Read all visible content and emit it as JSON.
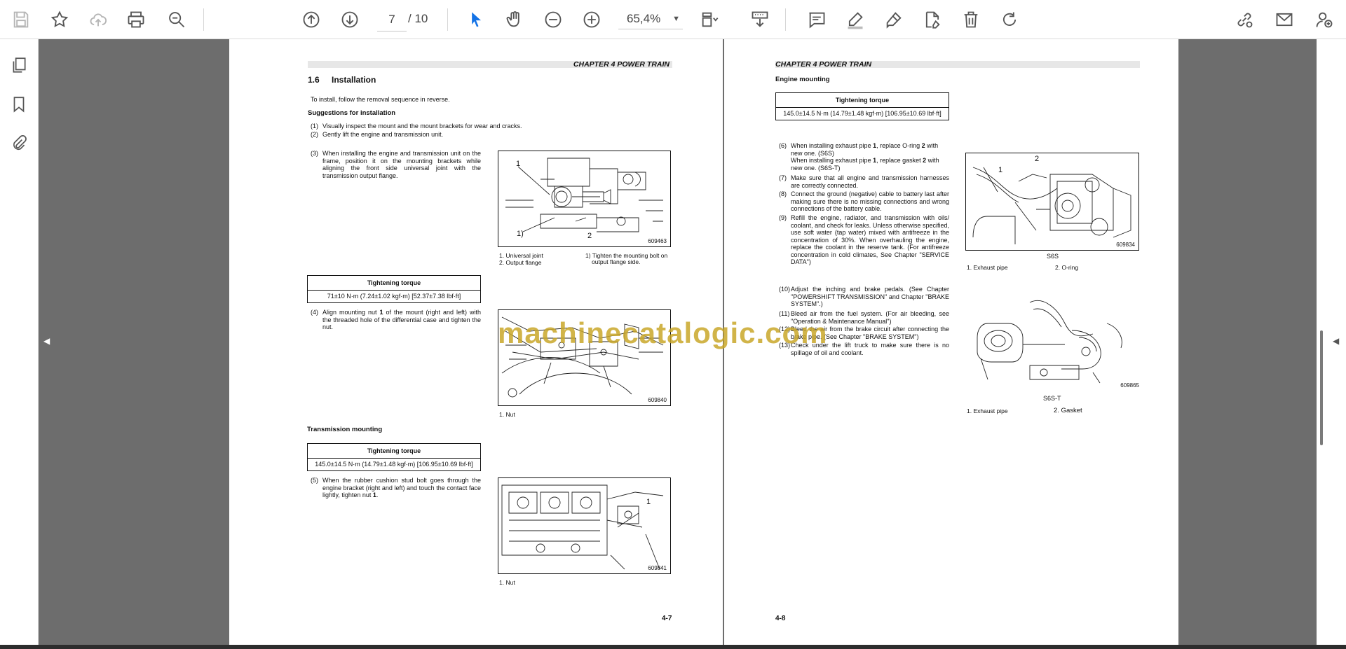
{
  "toolbar": {
    "current_page": "7",
    "total_pages": "/ 10",
    "zoom": "65,4%"
  },
  "watermark": "machinecatalogic.com",
  "left_page": {
    "chapter": "CHAPTER 4 POWER TRAIN",
    "section_num": "1.6",
    "section_title": "Installation",
    "intro": "To install, follow the removal sequence in reverse.",
    "suggestions_title": "Suggestions for installation",
    "steps": [
      {
        "num": "(1)",
        "text": "Visually inspect the mount and the mount brackets for wear and cracks."
      },
      {
        "num": "(2)",
        "text": "Gently lift the engine and transmission unit."
      },
      {
        "num": "(3)",
        "text": "When installing the engine and transmission unit on the frame, position it on the mounting brackets while aligning the front side universal joint with the transmission output flange."
      },
      {
        "num": "(4)",
        "text_a": "Align mounting nut ",
        "text_b": "1",
        "text_c": " of the mount (right and left) with the threaded hole of the differential case and tighten the nut."
      },
      {
        "num": "(5)",
        "text_a": "When the rubber cushion stud bolt goes through the engine bracket (right and left) and touch the contact face lightly, tighten nut ",
        "text_b": "1",
        "text_c": "."
      }
    ],
    "torque1": {
      "header": "Tightening torque",
      "value": "71±10 N·m (7.24±1.02 kgf·m) [52.37±7.38 lbf·ft]"
    },
    "transmission_title": "Transmission mounting",
    "torque2": {
      "header": "Tightening torque",
      "value": "145.0±14.5 N·m (14.79±1.48 kgf·m) [106.95±10.69 lbf·ft]"
    },
    "fig1": {
      "code": "609463",
      "label_1": "1",
      "label_2": "2",
      "label_1p": "1)",
      "cap_a": "1. Universal joint",
      "cap_b": "2. Output flange",
      "cap_c": "1) Tighten the mounting bolt on",
      "cap_d": "output flange side."
    },
    "fig2": {
      "code": "609840",
      "cap": "1. Nut"
    },
    "fig3": {
      "code": "609841",
      "label_1": "1",
      "cap": "1. Nut"
    },
    "page_num": "4-7"
  },
  "right_page": {
    "chapter": "CHAPTER 4 POWER TRAIN",
    "engine_title": "Engine mounting",
    "torque": {
      "header": "Tightening torque",
      "value": "145.0±14.5 N·m (14.79±1.48 kgf·m) [106.95±10.69 lbf·ft]"
    },
    "steps": [
      {
        "num": "(6)",
        "line1a": "When installing exhaust pipe ",
        "line1b": "1",
        "line1c": ", replace O-ring ",
        "line1d": "2",
        "line1e": " with new one. (S6S)",
        "line2a": "When installing exhaust pipe ",
        "line2b": "1",
        "line2c": ", replace gasket ",
        "line2d": "2",
        "line2e": " with new one. (S6S-T)"
      },
      {
        "num": "(7)",
        "text": "Make sure that all engine and transmission harnesses are correctly connected."
      },
      {
        "num": "(8)",
        "text": "Connect the ground (negative) cable to battery last after making sure there is no missing connections and wrong connections of the battery cable."
      },
      {
        "num": "(9)",
        "text": "Refill the engine, radiator, and transmission with oils/ coolant, and check for leaks. Unless otherwise specified, use soft water (tap water) mixed with antifreeze in the concentration of 30%. When overhauling the engine, replace the coolant in the reserve tank. (For antifreeze concentration in cold climates, See Chapter \"SERVICE DATA\")"
      },
      {
        "num": "(10)",
        "text": "Adjust the inching and brake pedals. (See Chapter \"POWERSHIFT TRANSMISSION\" and Chapter \"BRAKE SYSTEM\".)"
      },
      {
        "num": "(11)",
        "text": "Bleed air from the fuel system. (For air bleeding, see \"Operation & Maintenance Manual\")"
      },
      {
        "num": "(12)",
        "text": "Bleed the air from the brake circuit after connecting the brake pipe. (See Chapter \"BRAKE SYSTEM\")"
      },
      {
        "num": "(13)",
        "text": "Check under the lift truck to make sure there is no spillage of oil and coolant."
      }
    ],
    "fig1": {
      "code": "609834",
      "label_1": "1",
      "label_2": "2",
      "caption": "S6S",
      "cap_a": "1. Exhaust pipe",
      "cap_b": "2. O-ring"
    },
    "fig2": {
      "code": "609865",
      "caption": "S6S-T",
      "cap_a": "1. Exhaust pipe",
      "cap_b": "2. Gasket"
    },
    "page_num": "4-8"
  },
  "colors": {
    "doc_bg": "#6d6d6d",
    "accent": "#1473e6",
    "watermark": "#c9a72a"
  }
}
